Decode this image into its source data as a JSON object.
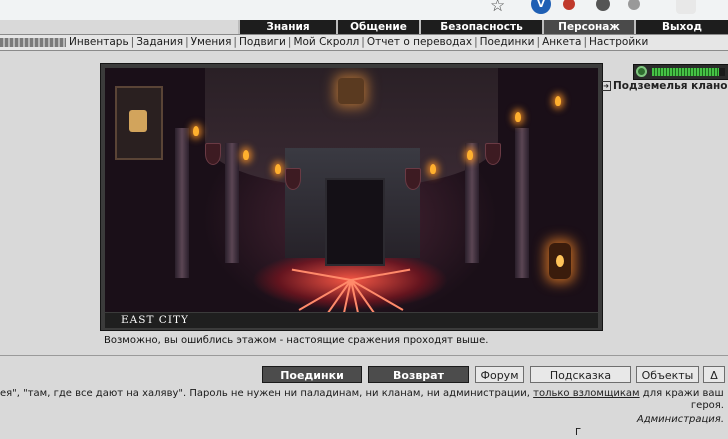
{
  "top_nav": [
    "Знания",
    "Общение",
    "Безопасность",
    "Персонаж",
    "Выход"
  ],
  "top_nav_active": "Персонаж",
  "sub_nav": [
    "Инвентарь",
    "Задания",
    "Умения",
    "Подвиги",
    "Мой Скролл",
    "Отчет о переводах",
    "Поединки",
    "Анкета",
    "Настройки"
  ],
  "location": {
    "label": "EAST CITY",
    "message": "Возможно, вы ошиблись этажом - настоящие сражения проходят выше."
  },
  "side": {
    "hp_level_percent": 92,
    "dungeons_link": "Подземелья кланов"
  },
  "bottom_buttons": {
    "fights": "Поединки",
    "back": "Возврат",
    "forum": "Форум",
    "hint": "Подсказка",
    "objects": "Объекты",
    "delta": "Δ"
  },
  "info": {
    "line1_prefix": "ея\", \"там, где все дают на халяву\". Пароль не нужен ни паладинам, ни кланам, ни администрации, ",
    "line1_link": "только взломщикам",
    "line1_suffix": " для кражи вашего",
    "line2": "героя.",
    "line3": "Администрация.",
    "line4": "Г"
  },
  "browser_ext": [
    "star",
    "V",
    "",
    "",
    "",
    ""
  ],
  "colors": {
    "page_bg": "#d9d9d9",
    "top_nav_bg": "#1d1d1d",
    "dark_button_bg": "#4c4c4c",
    "location_label_bg": "#1f1f1f",
    "hp_green": "#46c246"
  }
}
